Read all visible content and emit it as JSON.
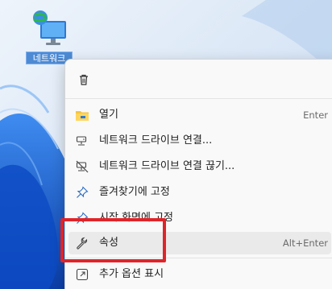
{
  "desktop": {
    "icon_label": "네트워크",
    "icon": "network-monitor-icon"
  },
  "context_menu": {
    "top_action_icon": "trash-icon",
    "items": [
      {
        "label": "열기",
        "accelerator": "Enter",
        "icon": "folder-icon"
      },
      {
        "label": "네트워크 드라이브 연결...",
        "accelerator": "",
        "icon": "map-drive-icon"
      },
      {
        "label": "네트워크 드라이브 연결 끊기...",
        "accelerator": "",
        "icon": "disconnect-drive-icon"
      },
      {
        "label": "즐겨찾기에 고정",
        "accelerator": "",
        "icon": "pin-icon"
      },
      {
        "label": "시작 화면에 고정",
        "accelerator": "",
        "icon": "pin-icon"
      },
      {
        "label": "속성",
        "accelerator": "Alt+Enter",
        "icon": "wrench-icon",
        "highlighted": true
      },
      {
        "label": "추가 옵션 표시",
        "accelerator": "",
        "icon": "open-external-icon"
      }
    ]
  },
  "colors": {
    "highlight_box": "#e0242a",
    "wallpaper_base": "#dbe8f6",
    "wallpaper_accent": "#1a63d8"
  }
}
